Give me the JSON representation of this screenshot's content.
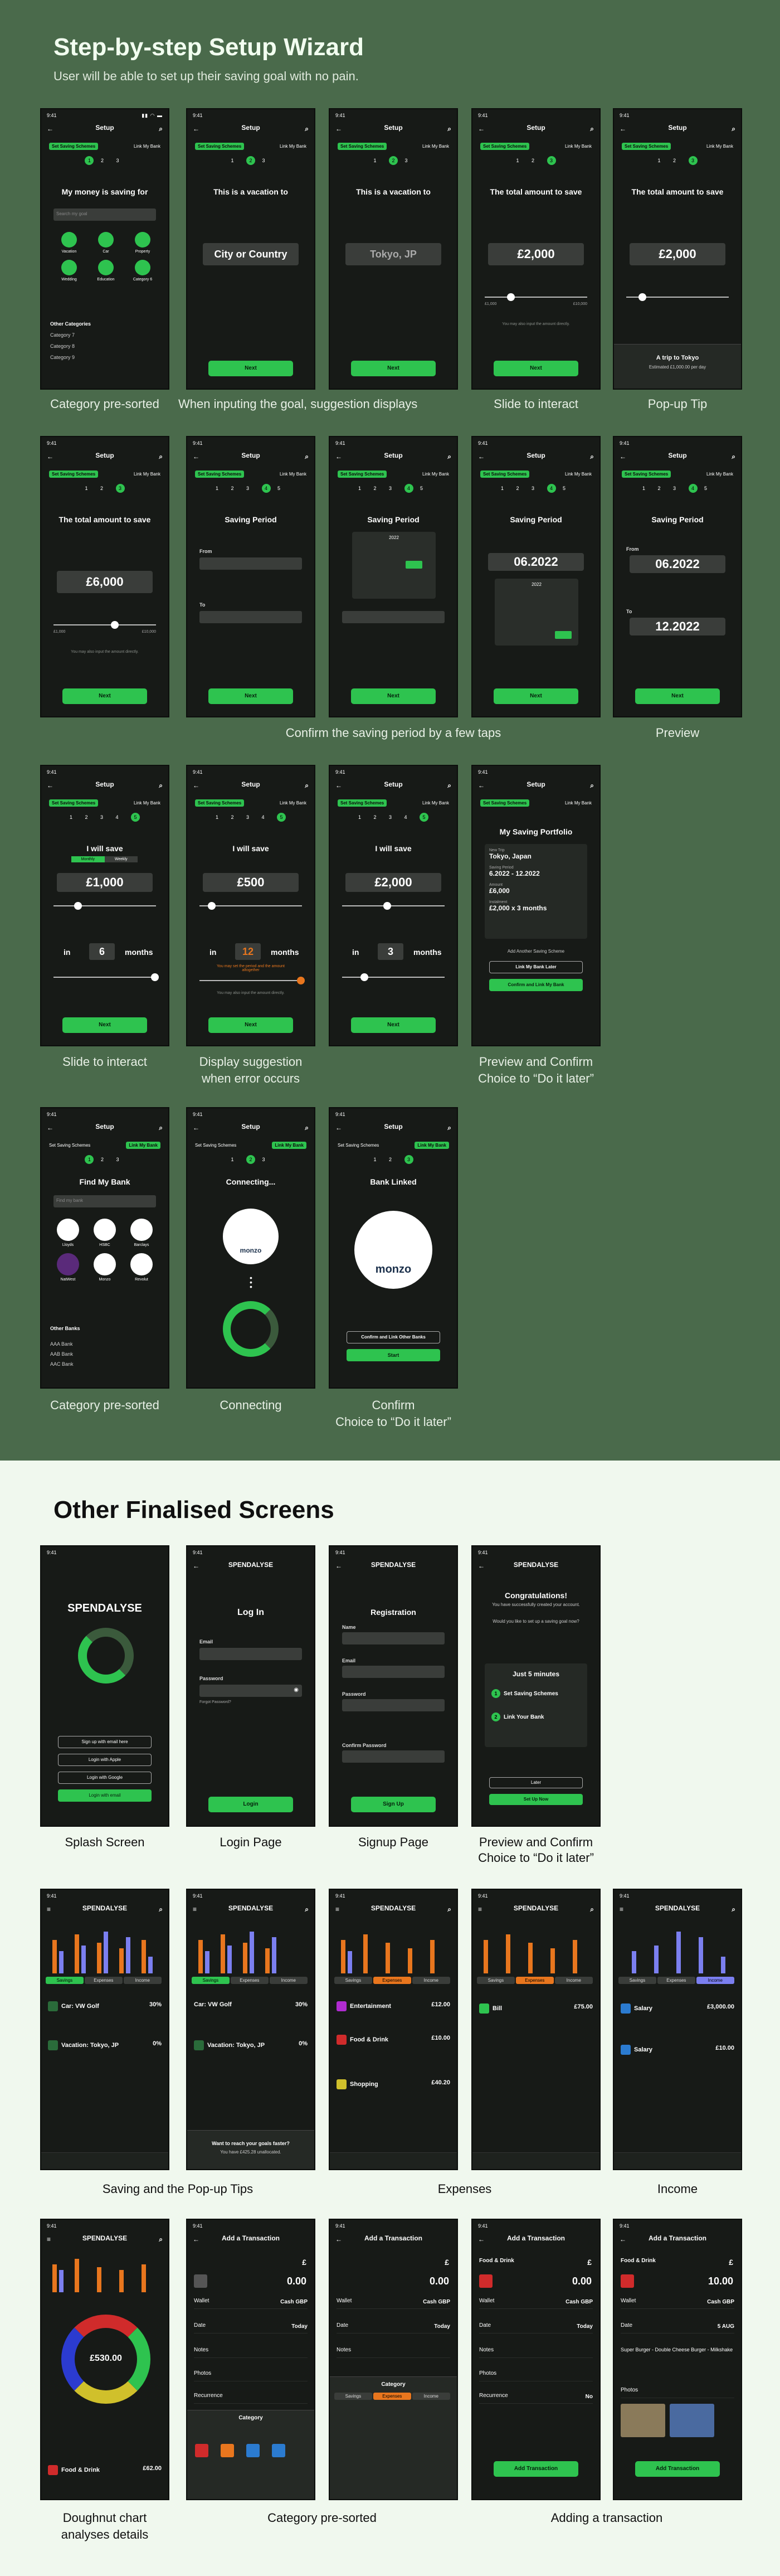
{
  "wizard": {
    "title": "Step-by-step Setup Wizard",
    "subtitle": "User will be able to set up their saving goal with no pain.",
    "setup_title": "Setup",
    "step1": "Set Saving Schemes",
    "step2": "Link My Bank",
    "status_time": "9:41",
    "next": "Next",
    "captions": {
      "c1": "Category pre-sorted",
      "c2": "When inputing the goal, suggestion displays",
      "c3": "Slide to interact",
      "c4": "Pop-up Tip",
      "c5": "Confirm the saving period by a few taps",
      "c6": "Preview",
      "c7": "Slide to interact",
      "c8a": "Display suggestion",
      "c8b": "when error occurs",
      "c9a": "Preview and Confirm",
      "c9b": "Choice to “Do it later”",
      "c10": "Category pre-sorted",
      "c11": "Connecting",
      "c12a": "Confirm",
      "c12b": "Choice to “Do it later”"
    },
    "s1": {
      "title": "My money is saving for",
      "search": "Search my goal",
      "cats": [
        "Vacation",
        "Car",
        "Property",
        "Wedding",
        "Education",
        "Category 6"
      ],
      "other": "Other Categories",
      "others": [
        "Category 7",
        "Category 8",
        "Category 9"
      ]
    },
    "s2": {
      "title": "This is a vacation to",
      "placeholder": "City or Country"
    },
    "s3": {
      "title": "This is a vacation to",
      "value": "Tokyo, JP"
    },
    "s4": {
      "title": "The total amount to save",
      "value": "£2,000",
      "min": "£1,000",
      "max": "£10,000",
      "hint": "You may also input the amount directly."
    },
    "s5": {
      "title": "The total amount to save",
      "value": "£2,000",
      "tip_title": "A trip to Tokyo",
      "tip_text": "Estimated £1,000.00 per day"
    },
    "s6": {
      "title": "The total amount to save",
      "value": "£6,000",
      "min": "£1,000",
      "max": "£10,000",
      "hint": "You may also input the amount directly."
    },
    "s7": {
      "title": "Saving Period",
      "from": "From",
      "to": "To"
    },
    "s8": {
      "title": "Saving Period",
      "year": "2022"
    },
    "s9": {
      "title": "Saving Period",
      "value": "06.2022",
      "year": "2022"
    },
    "s10": {
      "title": "Saving Period",
      "from": "From",
      "from_val": "06.2022",
      "to": "To",
      "to_val": "12.2022"
    },
    "s11": {
      "title": "I will save",
      "monthly": "Monthly",
      "weekly": "Weekly",
      "value": "£1,000",
      "in": "in",
      "months": "months",
      "count": "6"
    },
    "s12": {
      "title": "I will save",
      "value": "£500",
      "count": "12",
      "error": "You may set the period and the amount altogether",
      "hint": "You may also input the amount directly."
    },
    "s13": {
      "title": "I will save",
      "value": "£2,000",
      "count": "3"
    },
    "s14": {
      "title": "My Saving Portfolio",
      "new_trip": "New Trip",
      "dest": "Tokyo, Japan",
      "period_label": "Saving Period",
      "period": "6.2022 - 12.2022",
      "amount_label": "Amount",
      "amount": "£6,000",
      "inst_label": "Instalment",
      "inst": "£2,000 x 3 months",
      "add": "Add Another Saving Scheme",
      "later": "Link My Bank Later",
      "confirm": "Confirm and Link My Bank"
    },
    "s15": {
      "title": "Find My Bank",
      "search": "Find my bank",
      "banks": [
        "Lloyds",
        "HSBC",
        "Barclays",
        "NatWest",
        "Monzo",
        "Revolut"
      ],
      "other": "Other Banks",
      "others": [
        "AAA Bank",
        "AAB Bank",
        "AAC Bank"
      ]
    },
    "s16": {
      "title": "Connecting...",
      "brand": "monzo"
    },
    "s17": {
      "title": "Bank Linked",
      "brand": "monzo",
      "confirm": "Confirm and Link Other Banks",
      "start": "Start"
    }
  },
  "final": {
    "title": "Other Finalised Screens",
    "brand": "SPENDALYSE",
    "captions": {
      "c1": "Splash Screen",
      "c2": "Login Page",
      "c3": "Signup Page",
      "c4a": "Preview and Confirm",
      "c4b": "Choice to “Do it later”",
      "c5": "Saving and the Pop-up Tips",
      "c6": "Expenses",
      "c7": "Income",
      "c8a": "Doughnut chart",
      "c8b": "analyses details",
      "c9": "Category pre-sorted",
      "c10": "Adding a transaction"
    },
    "splash": {
      "btn1": "Sign up with email here",
      "btn2": "Login with Apple",
      "btn3": "Login with Google",
      "btn4": "Login with email"
    },
    "login": {
      "title": "Log In",
      "email": "Email",
      "password": "Password",
      "forgot": "Forgot Password?",
      "btn": "Login"
    },
    "signup": {
      "title": "Registration",
      "name": "Name",
      "email": "Email",
      "password": "Password",
      "confirm": "Confirm Password",
      "btn": "Sign Up"
    },
    "congrats": {
      "title": "Congratulations!",
      "l1": "You have successfully created your account.",
      "l2": "Would you like to set up a saving goal now?",
      "box": "Just 5 minutes",
      "s1": "Set Saving Schemes",
      "s2": "Link Your Bank",
      "later": "Later",
      "now": "Set Up Now"
    },
    "saving": {
      "tabs": [
        "Savings",
        "Expenses",
        "Income"
      ],
      "r1": "Car: VW Golf",
      "r1v": "30%",
      "r2": "Vacation: Tokyo, JP",
      "r2v": "0%",
      "tip": "Want to reach your goals faster?",
      "tip2": "You have £425.28 unallocated."
    },
    "expenses": {
      "r1": "Entertainment",
      "r1v": "£12.00",
      "r2": "Food & Drink",
      "r2v": "£10.00",
      "r3": "Shopping",
      "r3v": "£40.20",
      "r4": "Bill",
      "r4v": "£75.00"
    },
    "income": {
      "r1": "Salary",
      "r1v": "£3,000.00",
      "r2": "Salary",
      "r2v": "£10.00"
    },
    "donut": {
      "center": "£530.00",
      "row": "Food & Drink",
      "rowv": "£62.00"
    },
    "add": {
      "title": "Add a Transaction",
      "currency": "£",
      "amount": "0.00",
      "amount2": "10.00",
      "wallet": "Wallet",
      "wallet_v": "Cash GBP",
      "date": "Date",
      "date_v": "Today",
      "notes": "Notes",
      "photos": "Photos",
      "recurrence": "Recurrence",
      "recurrence_v": "No",
      "category": "Category",
      "cat_v": "Food & Drink",
      "date_v2": "5 AUG",
      "note_v": "Super Burger - Double Cheese Burger - Milkshake",
      "btn": "Add Transaction"
    }
  }
}
